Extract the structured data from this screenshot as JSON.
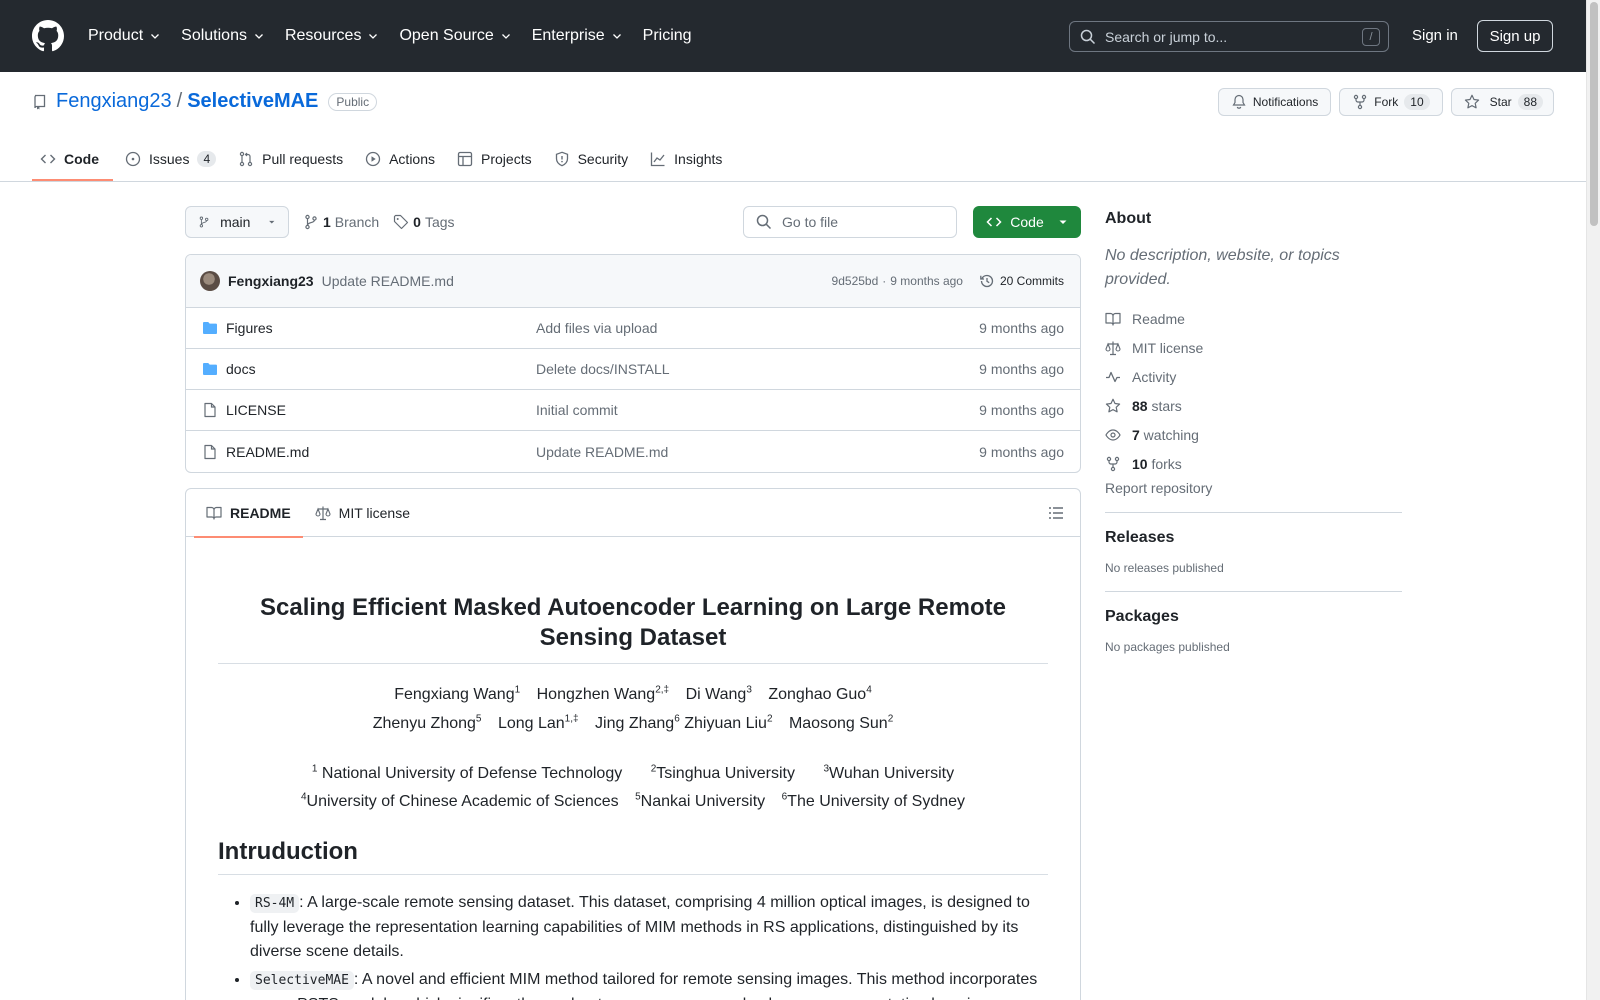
{
  "header": {
    "nav": [
      {
        "label": "Product",
        "has_chevron": true
      },
      {
        "label": "Solutions",
        "has_chevron": true
      },
      {
        "label": "Resources",
        "has_chevron": true
      },
      {
        "label": "Open Source",
        "has_chevron": true
      },
      {
        "label": "Enterprise",
        "has_chevron": true
      },
      {
        "label": "Pricing",
        "has_chevron": false
      }
    ],
    "search_placeholder": "Search or jump to...",
    "search_shortcut": "/",
    "signin_label": "Sign in",
    "signup_label": "Sign up"
  },
  "repo": {
    "owner": "Fengxiang23",
    "separator": "/",
    "name": "SelectiveMAE",
    "visibility": "Public",
    "notifications_label": "Notifications",
    "fork_label": "Fork",
    "fork_count": "10",
    "star_label": "Star",
    "star_count": "88",
    "tabs": [
      {
        "label": "Code",
        "icon": "code-icon",
        "active": true
      },
      {
        "label": "Issues",
        "icon": "issue-icon",
        "count": "4"
      },
      {
        "label": "Pull requests",
        "icon": "pull-request-icon"
      },
      {
        "label": "Actions",
        "icon": "play-icon"
      },
      {
        "label": "Projects",
        "icon": "table-icon"
      },
      {
        "label": "Security",
        "icon": "shield-icon"
      },
      {
        "label": "Insights",
        "icon": "graph-icon"
      }
    ]
  },
  "filebar": {
    "branch": "main",
    "branch_count": "1",
    "branch_label": "Branch",
    "tag_count": "0",
    "tag_label": "Tags",
    "goto_placeholder": "Go to file",
    "code_label": "Code"
  },
  "latest_commit": {
    "author": "Fengxiang23",
    "message": "Update README.md",
    "hash": "9d525bd",
    "dot": "·",
    "time": "9 months ago",
    "commits_label": "20 Commits"
  },
  "files": [
    {
      "name": "Figures",
      "type": "folder",
      "message": "Add files via upload",
      "time": "9 months ago"
    },
    {
      "name": "docs",
      "type": "folder",
      "message": "Delete docs/INSTALL",
      "time": "9 months ago"
    },
    {
      "name": "LICENSE",
      "type": "file",
      "message": "Initial commit",
      "time": "9 months ago"
    },
    {
      "name": "README.md",
      "type": "file",
      "message": "Update README.md",
      "time": "9 months ago"
    }
  ],
  "readme": {
    "tab_readme": "README",
    "tab_license": "MIT license",
    "title": "Scaling Efficient Masked Autoencoder Learning on Large Remote Sensing Dataset",
    "authors_line1": [
      {
        "name": "Fengxiang Wang",
        "sup": "1"
      },
      {
        "name": "Hongzhen Wang",
        "sup": "2,‡"
      },
      {
        "name": "Di Wang",
        "sup": "3"
      },
      {
        "name": "Zonghao Guo",
        "sup": "4"
      }
    ],
    "authors_line2": [
      {
        "name": "Zhenyu Zhong",
        "sup": "5"
      },
      {
        "name": "Long Lan",
        "sup": "1,‡"
      },
      {
        "name": "Jing Zhang",
        "sup": "6"
      },
      {
        "name": "Zhiyuan Liu",
        "sup": "2"
      },
      {
        "name": "Maosong Sun",
        "sup": "2"
      }
    ],
    "affil_line1": [
      {
        "sup": "1",
        "name": " National University of Defense Technology"
      },
      {
        "sup": "2",
        "name": "Tsinghua University"
      },
      {
        "sup": "3",
        "name": "Wuhan University"
      }
    ],
    "affil_line2": [
      {
        "sup": "4",
        "name": "University of Chinese Academic of Sciences"
      },
      {
        "sup": "5",
        "name": "Nankai University"
      },
      {
        "sup": "6",
        "name": "The University of Sydney"
      }
    ],
    "section_heading": "Intruduction",
    "bullets": [
      {
        "code": "RS-4M",
        "text": ": A large-scale remote sensing dataset. This dataset, comprising 4 million optical images, is designed to fully leverage the representation learning capabilities of MIM methods in RS applications, distinguished by its diverse scene details."
      },
      {
        "code": "SelectiveMAE",
        "text": ": A novel and efficient MIM method tailored for remote sensing images. This method incorporates a new PSTS module, which significantly accelerates convergence and enhances representation learning"
      }
    ]
  },
  "sidebar": {
    "about_heading": "About",
    "description": "No description, website, or topics provided.",
    "links": [
      {
        "icon": "book-icon",
        "bold": "",
        "label": "Readme"
      },
      {
        "icon": "law-icon",
        "bold": "",
        "label": "MIT license"
      },
      {
        "icon": "pulse-icon",
        "bold": "",
        "label": "Activity"
      },
      {
        "icon": "star-icon",
        "bold": "88",
        "label": " stars"
      },
      {
        "icon": "eye-icon",
        "bold": "7",
        "label": " watching"
      },
      {
        "icon": "fork-icon",
        "bold": "10",
        "label": " forks"
      }
    ],
    "report": "Report repository",
    "releases_heading": "Releases",
    "releases_text": "No releases published",
    "packages_heading": "Packages",
    "packages_text": "No packages published"
  }
}
